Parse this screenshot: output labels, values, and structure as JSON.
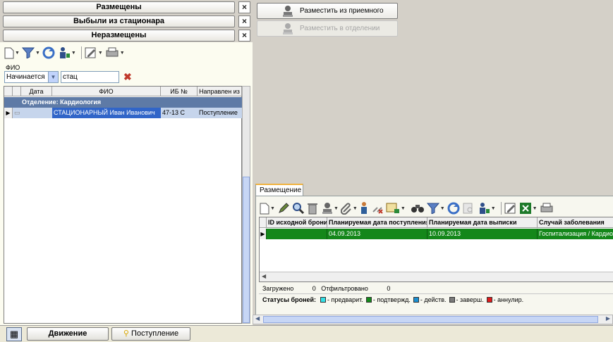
{
  "sections": [
    {
      "label": "Размещены",
      "close": "×"
    },
    {
      "label": "Выбыли из стационара",
      "close": "×"
    },
    {
      "label": "Неразмещены",
      "close": "×"
    }
  ],
  "filter": {
    "field_label": "ФИО",
    "condition": "Начинается",
    "value": "стац"
  },
  "left_grid": {
    "columns": [
      "Дата",
      "ФИО",
      "ИБ №",
      "Направлен из"
    ],
    "group_label": "Отделение: Кардиология",
    "row": {
      "fio": "СТАЦИОНАРНЫЙ Иван Иванович",
      "ib": "47-13 С",
      "from": "Поступление"
    }
  },
  "actions": {
    "place_from_reception": "Разместить из приемного",
    "place_in_department": "Разместить в отделении"
  },
  "placement": {
    "tab_label": "Размещение",
    "columns": [
      "ID исходной брони",
      "Планируемая дата поступления",
      "Планируемая дата выписки",
      "Случай заболевания"
    ],
    "row": {
      "id": "",
      "planned_in": "04.09.2013",
      "planned_out": "10.09.2013",
      "case": "Госпитализация / Кардиология"
    },
    "loaded_label": "Загружено",
    "loaded_value": "0",
    "filtered_label": "Отфильтровано",
    "filtered_value": "0",
    "legend_title": "Статусы броней:",
    "legend": [
      {
        "label": "- предварит.",
        "color": "#33e0e6"
      },
      {
        "label": "- подтвержд.",
        "color": "#13891a"
      },
      {
        "label": "- действ.",
        "color": "#1a8fd1"
      },
      {
        "label": "- заверш.",
        "color": "#7a7a7a"
      },
      {
        "label": "- аннулир.",
        "color": "#e01b1b"
      }
    ]
  },
  "bottom": {
    "movement_label": "Движение",
    "admission_label": "Поступление"
  }
}
